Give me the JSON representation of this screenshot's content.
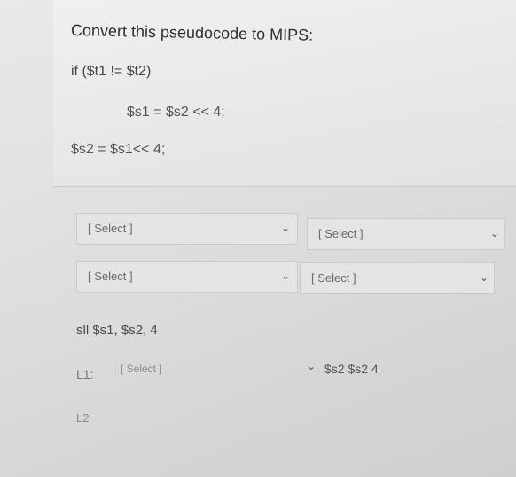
{
  "question": {
    "title": "Convert this pseudocode to MIPS:",
    "lines": {
      "if_line": "if ($t1 != $t2)",
      "s1_line": "$s1 = $s2 << 4;",
      "s2_line": "$s2 = $s1<< 4;"
    }
  },
  "answers": {
    "select_1": {
      "value": "[ Select ]"
    },
    "select_2": {
      "value": "[ Select ]"
    },
    "select_3": {
      "value": "[ Select ]"
    },
    "select_4": {
      "value": "[ Select ]"
    },
    "sll_line": "sll $s1, $s2, 4",
    "label_l1": "L1:",
    "select_5": {
      "value": "[ Select ]"
    },
    "s2_s2_4": "$s2  $s2 4",
    "label_l2": "L2"
  },
  "icons": {
    "dropdown": "chevron-down-icon"
  }
}
